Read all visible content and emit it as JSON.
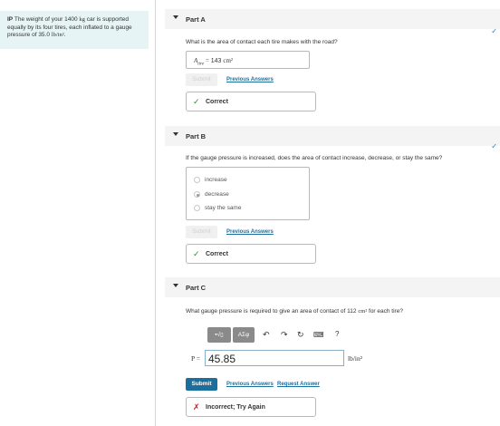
{
  "problem": {
    "prefix": "IP",
    "text1": "The weight of your 1400",
    "kg": "kg",
    "text2": "car is supported equally by its four tires, each inflated to a gauge pressure of 35.0",
    "unit": "lb/in²",
    "period": "."
  },
  "partA": {
    "title": "Part A",
    "question": "What is the area of contact each tire makes with the road?",
    "answer_label": "A",
    "answer_sub": "tire",
    "answer_value": "143",
    "answer_unit": "cm²",
    "submit": "Submit",
    "previous": "Previous Answers",
    "feedback": "Correct"
  },
  "partB": {
    "title": "Part B",
    "question": "If the gauge pressure is increased, does the area of contact increase, decrease, or stay the same?",
    "choices": [
      "increase",
      "decrease",
      "stay the same"
    ],
    "selected": "decrease",
    "submit": "Submit",
    "previous": "Previous Answers",
    "feedback": "Correct"
  },
  "partC": {
    "title": "Part C",
    "question_pre": "What gauge pressure is required to give an area of contact of 112",
    "question_unit": "cm²",
    "question_post": "for each tire?",
    "toolbar": {
      "matrix_label": "▪√▯",
      "greek_label": "ΑΣφ",
      "help_label": "?"
    },
    "var_label": "P =",
    "input_value": "45.85",
    "unit": "lb/in²",
    "submit": "Submit",
    "previous": "Previous Answers",
    "request": "Request Answer",
    "feedback": "Incorrect; Try Again"
  },
  "icons": {
    "check": "check-icon",
    "cross": "cross-icon",
    "undo": "undo-icon",
    "redo": "redo-icon",
    "reset": "reset-icon",
    "keyboard": "keyboard-icon"
  },
  "colors": {
    "accent": "#1a6f9f",
    "correct": "#2e8b3c",
    "incorrect": "#c81e1e",
    "problem_bg": "#e6f4f5"
  }
}
